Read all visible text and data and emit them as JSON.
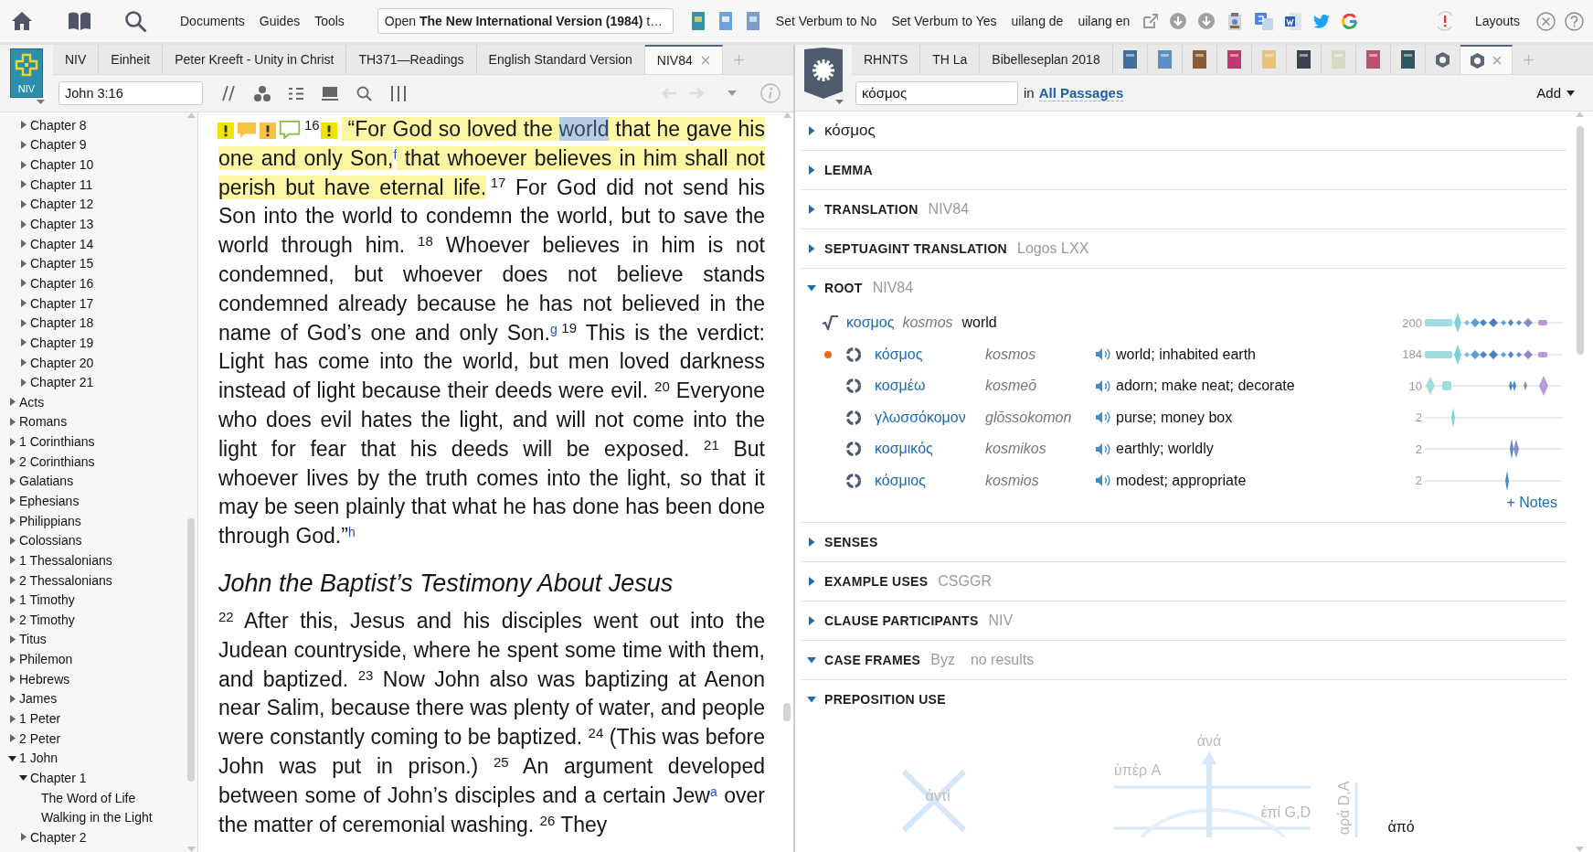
{
  "top_bar": {
    "menu": [
      "Documents",
      "Guides",
      "Tools"
    ],
    "open_field": "Open **The New International Version (1984)** t…",
    "commands": [
      "Set Verbum to No",
      "Set Verbum to Yes",
      "uilang de",
      "uilang en"
    ],
    "layouts": "Layouts"
  },
  "left_pane": {
    "logo_label": "NIV",
    "tabs": [
      {
        "label": "NIV",
        "selected": false
      },
      {
        "label": "Einheit",
        "selected": false
      },
      {
        "label": "Peter Kreeft - Unity in Christ",
        "selected": false
      },
      {
        "label": "TH371—Readings",
        "selected": false
      },
      {
        "label": "English Standard Version",
        "selected": false
      },
      {
        "label": "NIV84",
        "selected": true
      }
    ],
    "reference": "John 3:16",
    "history_nav": {
      "disabled": true
    },
    "tree": [
      {
        "kind": "group",
        "children": [
          {
            "kind": "branch",
            "label": "Chapter 8",
            "expanded": false
          },
          {
            "kind": "branch",
            "label": "Chapter 9",
            "expanded": false
          },
          {
            "kind": "branch",
            "label": "Chapter 10",
            "expanded": false
          },
          {
            "kind": "branch",
            "label": "Chapter 11",
            "expanded": false
          },
          {
            "kind": "branch",
            "label": "Chapter 12",
            "expanded": false
          },
          {
            "kind": "branch",
            "label": "Chapter 13",
            "expanded": false
          },
          {
            "kind": "branch",
            "label": "Chapter 14",
            "expanded": false
          },
          {
            "kind": "branch",
            "label": "Chapter 15",
            "expanded": false
          },
          {
            "kind": "branch",
            "label": "Chapter 16",
            "expanded": false
          },
          {
            "kind": "branch",
            "label": "Chapter 17",
            "expanded": false
          },
          {
            "kind": "branch",
            "label": "Chapter 18",
            "expanded": false
          },
          {
            "kind": "branch",
            "label": "Chapter 19",
            "expanded": false
          },
          {
            "kind": "branch",
            "label": "Chapter 20",
            "expanded": false
          },
          {
            "kind": "branch",
            "label": "Chapter 21",
            "expanded": false
          }
        ]
      },
      {
        "kind": "branch",
        "label": "Acts",
        "expanded": false
      },
      {
        "kind": "branch",
        "label": "Romans",
        "expanded": false
      },
      {
        "kind": "branch",
        "label": "1 Corinthians",
        "expanded": false
      },
      {
        "kind": "branch",
        "label": "2 Corinthians",
        "expanded": false
      },
      {
        "kind": "branch",
        "label": "Galatians",
        "expanded": false
      },
      {
        "kind": "branch",
        "label": "Ephesians",
        "expanded": false
      },
      {
        "kind": "branch",
        "label": "Philippians",
        "expanded": false
      },
      {
        "kind": "branch",
        "label": "Colossians",
        "expanded": false
      },
      {
        "kind": "branch",
        "label": "1 Thessalonians",
        "expanded": false
      },
      {
        "kind": "branch",
        "label": "2 Thessalonians",
        "expanded": false
      },
      {
        "kind": "branch",
        "label": "1 Timothy",
        "expanded": false
      },
      {
        "kind": "branch",
        "label": "2 Timothy",
        "expanded": false
      },
      {
        "kind": "branch",
        "label": "Titus",
        "expanded": false
      },
      {
        "kind": "branch",
        "label": "Philemon",
        "expanded": false
      },
      {
        "kind": "branch",
        "label": "Hebrews",
        "expanded": false
      },
      {
        "kind": "branch",
        "label": "James",
        "expanded": false
      },
      {
        "kind": "branch",
        "label": "1 Peter",
        "expanded": false
      },
      {
        "kind": "branch",
        "label": "2 Peter",
        "expanded": false
      },
      {
        "kind": "branch",
        "label": "1 John",
        "expanded": true,
        "children": [
          {
            "kind": "branch",
            "label": "Chapter 1",
            "expanded": true,
            "children": [
              {
                "kind": "leaf",
                "label": "The Word of Life"
              },
              {
                "kind": "leaf",
                "label": "Walking in the Light"
              }
            ]
          },
          {
            "kind": "branch",
            "label": "Chapter 2",
            "expanded": false
          }
        ]
      }
    ],
    "content": [
      {
        "kind": "paragraph",
        "segments": [
          {
            "kind": "note_icons"
          },
          {
            "kind": "verse",
            "text": "16"
          },
          {
            "kind": "flag_icon"
          },
          {
            "kind": "highlight",
            "text": " “For God so loved the "
          },
          {
            "kind": "selection",
            "text": "world"
          },
          {
            "kind": "highlight",
            "text": " that he gave his one and only Son,"
          },
          {
            "kind": "note",
            "text": "f"
          },
          {
            "kind": "highlight",
            "text": " that whoever believes in him shall not perish but have eternal life."
          },
          {
            "kind": "verse",
            "text": "17"
          },
          {
            "kind": "text",
            "text": " For God did not send his Son into the world to condemn the world, but to save the world through him. "
          },
          {
            "kind": "verse",
            "text": "18"
          },
          {
            "kind": "text",
            "text": " Whoever believes in him is not condemned, but whoever does not believe stands condemned already because he has not believed in the name of God’s one and only Son."
          },
          {
            "kind": "note",
            "text": "g"
          },
          {
            "kind": "verse",
            "text": "19"
          },
          {
            "kind": "text",
            "text": " This is the verdict: Light has come into the world, but men loved darkness instead of light because their deeds were evil. "
          },
          {
            "kind": "verse",
            "text": "20"
          },
          {
            "kind": "text",
            "text": " Everyone who does evil hates the light, and will not come into the light for fear that his deeds will be exposed. "
          },
          {
            "kind": "verse",
            "text": "21"
          },
          {
            "kind": "text",
            "text": " But whoever lives by the truth comes into the light, so that it may be seen plainly that what he has done has been done through God.”"
          },
          {
            "kind": "note",
            "text": "h"
          }
        ]
      },
      {
        "kind": "heading",
        "text": "John the Baptist’s Testimony About Jesus"
      },
      {
        "kind": "paragraph",
        "segments": [
          {
            "kind": "verse",
            "text": "22"
          },
          {
            "kind": "text",
            "text": " After this, Jesus and his disciples went out into the Judean countryside, where he spent some time with them, and baptized. "
          },
          {
            "kind": "verse",
            "text": "23"
          },
          {
            "kind": "text",
            "text": " Now John also was baptizing at Aenon near Salim, because there was plenty of water, and people were constantly coming to be baptized. "
          },
          {
            "kind": "verse",
            "text": "24"
          },
          {
            "kind": "text",
            "text": " (This was before John was put in prison.) "
          },
          {
            "kind": "verse",
            "text": "25"
          },
          {
            "kind": "text",
            "text": " An argument developed between some of John’s disciples and a certain Jew"
          },
          {
            "kind": "note",
            "text": "a"
          },
          {
            "kind": "text",
            "text": " over the matter of ceremonial washing. "
          },
          {
            "kind": "verse",
            "text": "26"
          },
          {
            "kind": "text",
            "text": " They"
          }
        ]
      }
    ]
  },
  "right_pane": {
    "tabs": [
      {
        "kind": "text",
        "label": "RHNTS",
        "selected": false
      },
      {
        "kind": "text",
        "label": "TH La",
        "selected": false
      },
      {
        "kind": "text",
        "label": "Bibelleseplan 2018",
        "selected": false
      },
      {
        "kind": "cover",
        "color": "#3f6f9e",
        "selected": false
      },
      {
        "kind": "cover",
        "color": "#5b8fc4",
        "selected": false
      },
      {
        "kind": "cover",
        "color": "#8a5a32",
        "selected": false
      },
      {
        "kind": "cover",
        "color": "#c2376e",
        "selected": false
      },
      {
        "kind": "cover",
        "color": "#e6c27a",
        "selected": false
      },
      {
        "kind": "cover",
        "color": "#3b4252",
        "selected": false
      },
      {
        "kind": "cover",
        "color": "#d9d8c2",
        "selected": false
      },
      {
        "kind": "cover",
        "color": "#b8526a",
        "selected": false
      },
      {
        "kind": "cover",
        "color": "#2f5563",
        "selected": false
      },
      {
        "kind": "icon",
        "selected": false
      },
      {
        "kind": "icon",
        "selected": true
      }
    ],
    "query": "κόσμος",
    "scope_prefix": "in",
    "scope": "All Passages",
    "add_button": "Add",
    "sections": [
      {
        "kind": "word",
        "title": "κόσμος",
        "expanded": false
      },
      {
        "kind": "section",
        "title": "LEMMA",
        "expanded": false
      },
      {
        "kind": "section",
        "title": "TRANSLATION",
        "source": "NIV84",
        "expanded": false
      },
      {
        "kind": "section",
        "title": "SEPTUAGINT TRANSLATION",
        "source": "Logos LXX",
        "expanded": false
      },
      {
        "kind": "section",
        "title": "ROOT",
        "source": "NIV84",
        "expanded": true,
        "root": {
          "lemma": "κοσμος",
          "translit": "kosmos",
          "gloss": "world",
          "count": "200"
        },
        "words": [
          {
            "lemma": "κόσμος",
            "translit": "kosmos",
            "gloss": "world; inhabited earth",
            "count": "184",
            "current": true
          },
          {
            "lemma": "κοσμέω",
            "translit": "kosmeō",
            "gloss": "adorn; make neat; decorate",
            "count": "10",
            "current": false
          },
          {
            "lemma": "γλωσσόκομον",
            "translit": "glōssokomon",
            "gloss": "purse; money box",
            "count": "2",
            "current": false
          },
          {
            "lemma": "κοσμικός",
            "translit": "kosmikos",
            "gloss": "earthly; worldly",
            "count": "2",
            "current": false
          },
          {
            "lemma": "κόσμιος",
            "translit": "kosmios",
            "gloss": "modest; appropriate",
            "count": "2",
            "current": false
          }
        ],
        "notes_link": "+ Notes"
      },
      {
        "kind": "section",
        "title": "SENSES",
        "expanded": false
      },
      {
        "kind": "section",
        "title": "EXAMPLE USES",
        "source": "CSGGR",
        "expanded": false
      },
      {
        "kind": "section",
        "title": "CLAUSE PARTICIPANTS",
        "source": "NIV",
        "expanded": false
      },
      {
        "kind": "section",
        "title": "CASE FRAMES",
        "source": "Byz",
        "note": "no results",
        "expanded": true
      },
      {
        "kind": "section",
        "title": "PREPOSITION USE",
        "expanded": true,
        "prepositions": [
          {
            "label": "ἀνά",
            "active": false
          },
          {
            "label": "ὑπέρ A",
            "active": false
          },
          {
            "label": "ἐπί G,D",
            "active": false
          },
          {
            "label": "ἀντί",
            "active": false
          },
          {
            "label": "αρά D,A",
            "active": false
          },
          {
            "label": "ἀπό",
            "active": true
          }
        ]
      }
    ]
  }
}
